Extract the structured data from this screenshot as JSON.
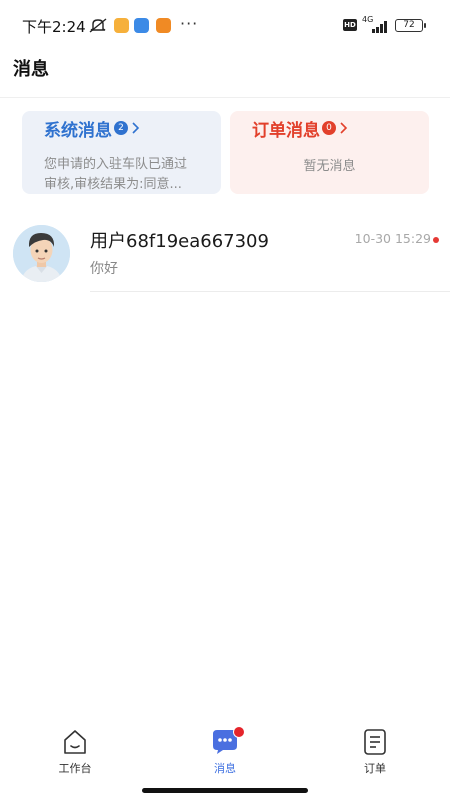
{
  "status_bar": {
    "time": "下午2:24",
    "network": "4G",
    "hd": "HD",
    "battery": "72",
    "more": "···",
    "icons": [
      "mute-icon",
      "app-icon",
      "app-icon",
      "app-icon",
      "signal-icon"
    ]
  },
  "header": {
    "title": "消息"
  },
  "cards": {
    "system": {
      "title": "系统消息",
      "badge": "2",
      "line1": "您申请的入驻车队已通过",
      "line2": "审核,审核结果为:同意..."
    },
    "order": {
      "title": "订单消息",
      "badge": "0",
      "empty": "暂无消息"
    }
  },
  "chats": [
    {
      "name": "用户68f19ea667309",
      "time": "10-30 15:29",
      "preview": "你好"
    }
  ],
  "nav": {
    "items": [
      {
        "label": "工作台",
        "icon": "home-icon"
      },
      {
        "label": "消息",
        "icon": "chat-icon"
      },
      {
        "label": "订单",
        "icon": "document-icon"
      }
    ]
  },
  "colors": {
    "accent_blue": "#2f72cf",
    "accent_red": "#e2402b",
    "nav_active": "#3d6fe0"
  }
}
